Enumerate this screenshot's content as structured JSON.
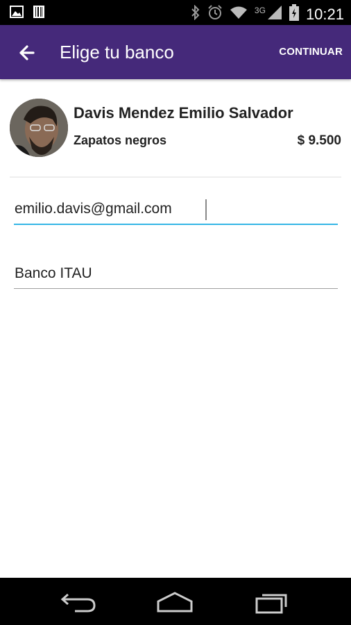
{
  "status_bar": {
    "time": "10:21",
    "network": "3G"
  },
  "app_bar": {
    "title": "Elige tu banco",
    "continue_label": "CONTINUAR"
  },
  "profile": {
    "name": "Davis Mendez Emilio Salvador",
    "item": "Zapatos negros",
    "price": "$ 9.500"
  },
  "form": {
    "email_value": "emilio.davis@gmail.com",
    "bank_value": "Banco ITAU"
  },
  "colors": {
    "app_bar": "#45297a",
    "focus_underline": "#33b5e5"
  },
  "icons": [
    "image-icon",
    "barcode-icon",
    "bluetooth-icon",
    "alarm-icon",
    "wifi-icon",
    "signal-icon",
    "battery-icon",
    "arrow-back-icon",
    "nav-back-icon",
    "nav-home-icon",
    "nav-recent-icon"
  ]
}
